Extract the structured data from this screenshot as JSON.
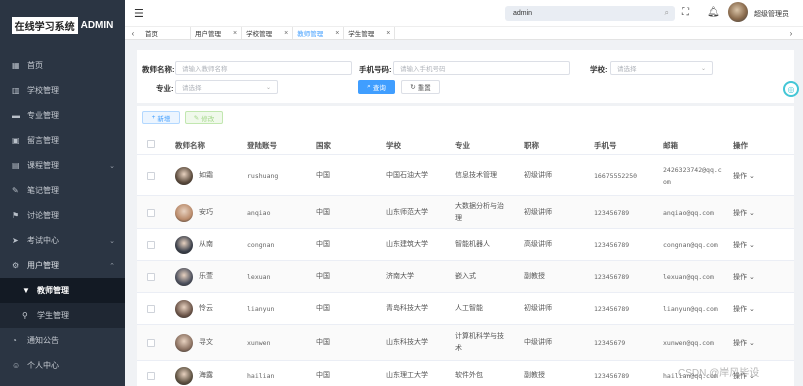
{
  "sidebar": {
    "logo_highlight": "在线学习系统",
    "logo_text": "ADMIN",
    "items": [
      {
        "label": "首页",
        "icon": "grid-icon"
      },
      {
        "label": "学校管理",
        "icon": "school-icon"
      },
      {
        "label": "专业管理",
        "icon": "monitor-icon"
      },
      {
        "label": "留言管理",
        "icon": "message-icon"
      },
      {
        "label": "课程管理",
        "icon": "calendar-icon"
      },
      {
        "label": "笔记管理",
        "icon": "edit-icon"
      },
      {
        "label": "讨论管理",
        "icon": "flag-icon"
      },
      {
        "label": "考试中心",
        "icon": "send-icon"
      },
      {
        "label": "用户管理",
        "icon": "settings-icon"
      }
    ],
    "sub_items": [
      {
        "label": "教师管理",
        "active": true
      },
      {
        "label": "学生管理",
        "active": false
      }
    ],
    "bottom_items": [
      {
        "label": "通知公告"
      },
      {
        "label": "个人中心"
      }
    ]
  },
  "header": {
    "search_value": "admin",
    "username": "超级管理员"
  },
  "tabs": [
    {
      "label": "首页",
      "closable": false,
      "active": false
    },
    {
      "label": "用户管理",
      "closable": true,
      "active": false
    },
    {
      "label": "学校管理",
      "closable": true,
      "active": false
    },
    {
      "label": "教师管理",
      "closable": true,
      "active": true
    },
    {
      "label": "学生管理",
      "closable": true,
      "active": false
    }
  ],
  "filter": {
    "name_label": "教师名称:",
    "name_placeholder": "请输入教师名称",
    "phone_label": "手机号码:",
    "phone_placeholder": "请输入手机号码",
    "school_label": "学校:",
    "school_placeholder": "请选择",
    "major_label": "专业:",
    "major_placeholder": "请选择",
    "search_button": "查询",
    "reset_button": "重置"
  },
  "toolbar": {
    "add_label": "新增",
    "edit_label": "修改"
  },
  "table": {
    "headers": [
      "教师名称",
      "登陆账号",
      "国家",
      "学校",
      "专业",
      "职称",
      "手机号",
      "邮箱",
      "操作"
    ],
    "rows": [
      {
        "name": "如霜",
        "account": "rushuang",
        "country": "中国",
        "school": "中国石油大学",
        "major": "信息技术管理",
        "title": "初级讲师",
        "phone": "16675552250",
        "email_1": "2426323742@qq.c",
        "email_2": "om",
        "action": "操作",
        "avatar_color": "#5a4a3c"
      },
      {
        "name": "安巧",
        "account": "anqiao",
        "country": "中国",
        "school": "山东师范大学",
        "major": "大数据分析与治",
        "major_2": "理",
        "title": "初级讲师",
        "phone": "123456789",
        "email_1": "anqiao@qq.com",
        "action": "操作",
        "avatar_color": "#b98a6a"
      },
      {
        "name": "从南",
        "account": "congnan",
        "country": "中国",
        "school": "山东建筑大学",
        "major": "智能机器人",
        "title": "高级讲师",
        "phone": "123456789",
        "email_1": "congnan@qq.com",
        "action": "操作",
        "avatar_color": "#3a3f4a"
      },
      {
        "name": "乐萱",
        "account": "lexuan",
        "country": "中国",
        "school": "济南大学",
        "major": "嵌入式",
        "title": "副教授",
        "phone": "123456789",
        "email_1": "lexuan@qq.com",
        "action": "操作",
        "avatar_color": "#4b4f5c"
      },
      {
        "name": "怜云",
        "account": "lianyun",
        "country": "中国",
        "school": "青岛科技大学",
        "major": "人工智能",
        "title": "初级讲师",
        "phone": "123456789",
        "email_1": "lianyun@qq.com",
        "action": "操作",
        "avatar_color": "#6b5448"
      },
      {
        "name": "寻文",
        "account": "xunwen",
        "country": "中国",
        "school": "山东科技大学",
        "major": "计算机科学与技",
        "major_2": "术",
        "title": "中级讲师",
        "phone": "12345679",
        "email_1": "xunwen@qq.com",
        "action": "操作",
        "avatar_color": "#8a7060"
      },
      {
        "name": "海露",
        "account": "hailian",
        "country": "中国",
        "school": "山东理工大学",
        "major": "软件外包",
        "title": "副教授",
        "phone": "123456789",
        "email_1": "hailian@qq.com",
        "action": "操作",
        "avatar_color": "#5c5040"
      }
    ]
  },
  "watermark": "CSDN @岸风毕设",
  "colors": {
    "sidebar_bg": "#2b3543",
    "primary": "#409eff",
    "active_sub_bg": "#131a24"
  }
}
